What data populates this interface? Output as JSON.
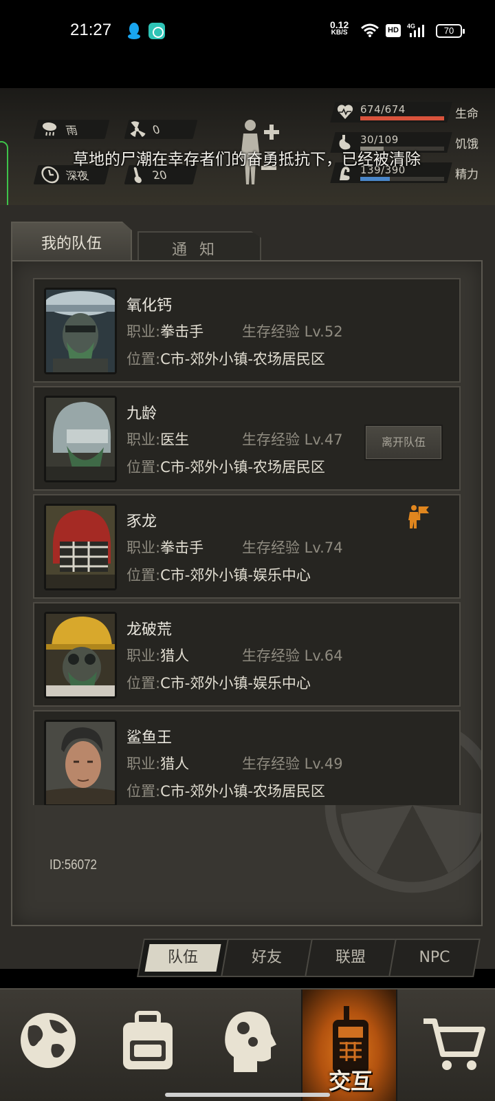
{
  "status_bar": {
    "time": "21:27",
    "net_speed_value": "0.12",
    "net_speed_unit": "KB/S",
    "hd_label": "HD",
    "signal_label": "4G",
    "battery": "70"
  },
  "hud": {
    "weather": "雨",
    "radiation": "0",
    "time_of_day": "深夜",
    "temperature": "20",
    "toast": "草地的尸潮在幸存者们的奋勇抵抗下，已经被清除",
    "stats": [
      {
        "name": "生命",
        "value": "674/674",
        "fraction": 1.0,
        "color": "#d9533c",
        "icon": "heart-pulse-icon"
      },
      {
        "name": "饥饿",
        "value": "30/109",
        "fraction": 0.275,
        "color": "#8a877d",
        "icon": "stomach-icon"
      },
      {
        "name": "精力",
        "value": "139/390",
        "fraction": 0.356,
        "color": "#4a86c8",
        "icon": "energy-arm-icon"
      }
    ]
  },
  "tabs": {
    "my_team": "我的队伍",
    "notice": "通知"
  },
  "labels": {
    "job_prefix": "职业:",
    "location_prefix": "位置:",
    "exp_prefix": "生存经验 Lv.",
    "leave_team": "离开队伍"
  },
  "members": [
    {
      "name": "氧化钙",
      "job": "拳击手",
      "level": "52",
      "location": "C市-郊外小镇-农场居民区"
    },
    {
      "name": "九龄",
      "job": "医生",
      "level": "47",
      "location": "C市-郊外小镇-农场居民区"
    },
    {
      "name": "豕龙",
      "job": "拳击手",
      "level": "74",
      "location": "C市-郊外小镇-娱乐中心"
    },
    {
      "name": "龙破荒",
      "job": "猎人",
      "level": "64",
      "location": "C市-郊外小镇-娱乐中心"
    },
    {
      "name": "鲨鱼王",
      "job": "猎人",
      "level": "49",
      "location": "C市-郊外小镇-农场居民区"
    }
  ],
  "id_text": "ID:56072",
  "subtabs": [
    "队伍",
    "好友",
    "联盟",
    "NPC"
  ],
  "bottom_nav": {
    "items": [
      "globe-icon",
      "backpack-icon",
      "head-gears-icon",
      "walkie-talkie-icon",
      "cart-icon"
    ],
    "active_label": "交互"
  }
}
